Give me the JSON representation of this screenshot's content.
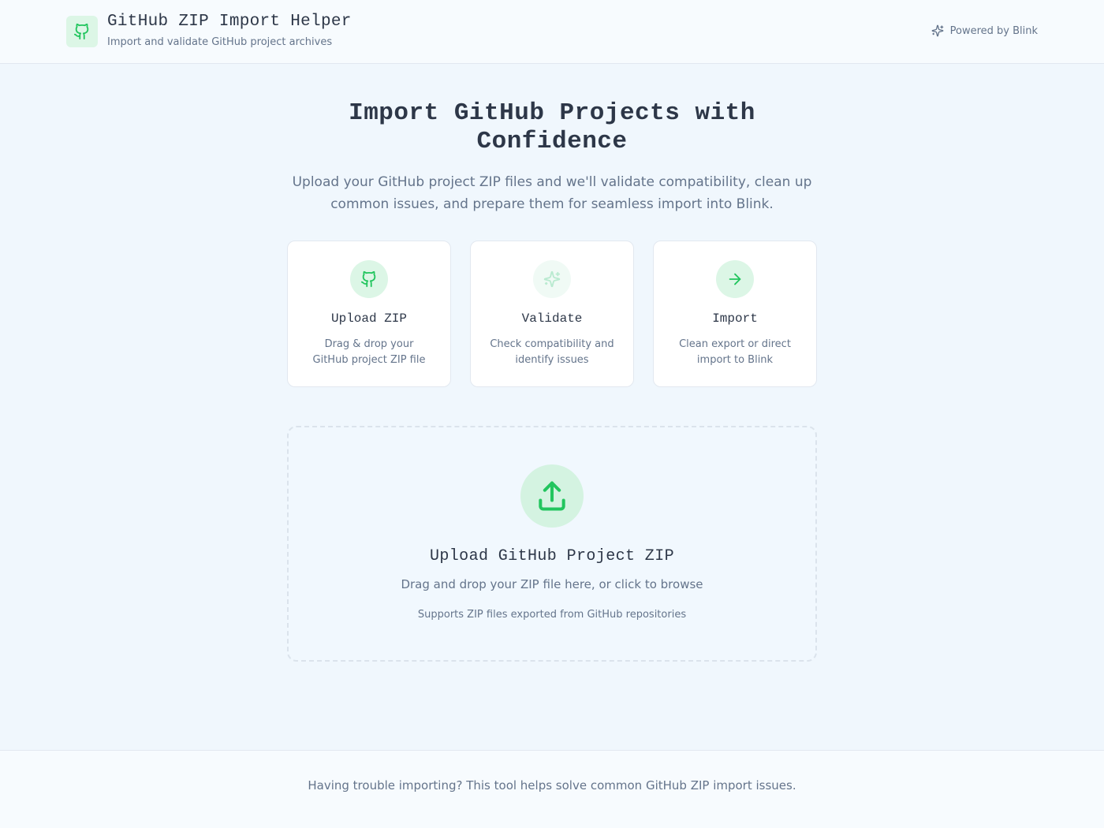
{
  "header": {
    "logo_icon": "github-icon",
    "title": "GitHub ZIP Import Helper",
    "subtitle": "Import and validate GitHub project archives",
    "powered_icon": "sparkles-icon",
    "powered_label": "Powered by Blink"
  },
  "hero": {
    "title": "Import GitHub Projects with Confidence",
    "description": "Upload your GitHub project ZIP files and we'll validate compatibility, clean up common issues, and prepare them for seamless import into Blink."
  },
  "steps": [
    {
      "icon": "github-icon",
      "title": "Upload ZIP",
      "description": "Drag & drop your GitHub project ZIP file"
    },
    {
      "icon": "sparkles-icon",
      "title": "Validate",
      "description": "Check compatibility and identify issues"
    },
    {
      "icon": "arrow-right-icon",
      "title": "Import",
      "description": "Clean export or direct import to Blink"
    }
  ],
  "dropzone": {
    "icon": "upload-icon",
    "title": "Upload GitHub Project ZIP",
    "description": "Drag and drop your ZIP file here, or click to browse",
    "note": "Supports ZIP files exported from GitHub repositories"
  },
  "footer": {
    "text": "Having trouble importing? This tool helps solve common GitHub ZIP import issues."
  },
  "colors": {
    "accent": "#22c55e",
    "accent_light": "#dcf6e6",
    "background": "#f0f7fd",
    "text_dark": "#2d3748",
    "text_muted": "#64748b"
  }
}
